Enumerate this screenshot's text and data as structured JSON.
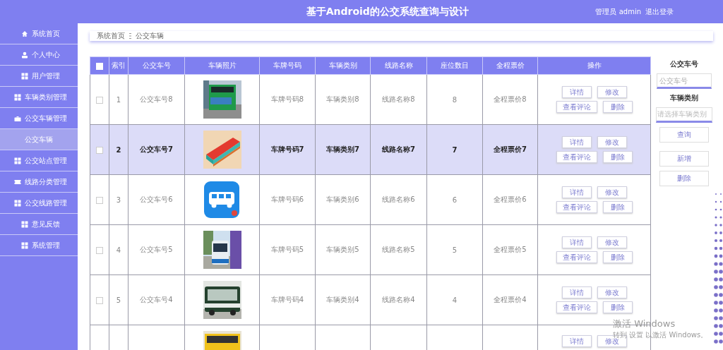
{
  "header": {
    "title": "基于Android的公交系统查询与设计",
    "user": "管理员 admin",
    "logout": "退出登录"
  },
  "sidebar": {
    "items": [
      {
        "label": "系统首页",
        "kind": "item",
        "selected": false
      },
      {
        "label": "个人中心",
        "kind": "item",
        "selected": false
      },
      {
        "label": "用户管理",
        "kind": "item",
        "selected": false
      },
      {
        "label": "车辆类别管理",
        "kind": "item",
        "selected": false
      },
      {
        "label": "公交车辆管理",
        "kind": "item",
        "selected": false
      },
      {
        "label": "公交车辆",
        "kind": "subitem",
        "selected": true
      },
      {
        "label": "公交站点管理",
        "kind": "item",
        "selected": false
      },
      {
        "label": "线路分类管理",
        "kind": "item",
        "selected": false
      },
      {
        "label": "公交线路管理",
        "kind": "item",
        "selected": false
      },
      {
        "label": "意见反馈",
        "kind": "item",
        "selected": false
      },
      {
        "label": "系统管理",
        "kind": "item",
        "selected": false
      }
    ]
  },
  "breadcrumb": [
    "系统首页",
    "公交车辆"
  ],
  "table": {
    "select_all": {
      "checked": false
    },
    "columns": [
      "索引",
      "公交车号",
      "车辆照片",
      "车牌号码",
      "车辆类别",
      "线路名称",
      "座位数目",
      "全程票价",
      "操作"
    ],
    "rows": [
      {
        "index": "1",
        "bus_no": "公交车号8",
        "photo": {
          "kind": "picture"
        },
        "plate": "车牌号码8",
        "category": "车辆类别8",
        "route": "线路名称8",
        "seats": "8",
        "fare": "全程票价8",
        "actions": [
          "详情",
          "修改",
          "查看评论",
          "删除"
        ],
        "selected": false,
        "checked": false
      },
      {
        "index": "2",
        "bus_no": "公交车号7",
        "photo": {
          "kind": "picture"
        },
        "plate": "车牌号码7",
        "category": "车辆类别7",
        "route": "线路名称7",
        "seats": "7",
        "fare": "全程票价7",
        "actions": [
          "详情",
          "修改",
          "查看评论",
          "删除"
        ],
        "selected": true,
        "checked": false
      },
      {
        "index": "3",
        "bus_no": "公交车号6",
        "photo": {
          "kind": "picture"
        },
        "plate": "车牌号码6",
        "category": "车辆类别6",
        "route": "线路名称6",
        "seats": "6",
        "fare": "全程票价6",
        "actions": [
          "详情",
          "修改",
          "查看评论",
          "删除"
        ],
        "selected": false,
        "checked": false
      },
      {
        "index": "4",
        "bus_no": "公交车号5",
        "photo": {
          "kind": "picture"
        },
        "plate": "车牌号码5",
        "category": "车辆类别5",
        "route": "线路名称5",
        "seats": "5",
        "fare": "全程票价5",
        "actions": [
          "详情",
          "修改",
          "查看评论",
          "删除"
        ],
        "selected": false,
        "checked": false
      },
      {
        "index": "5",
        "bus_no": "公交车号4",
        "photo": {
          "kind": "picture"
        },
        "plate": "车牌号码4",
        "category": "车辆类别4",
        "route": "线路名称4",
        "seats": "4",
        "fare": "全程票价4",
        "actions": [
          "详情",
          "修改",
          "查看评论",
          "删除"
        ],
        "selected": false,
        "checked": false
      },
      {
        "photo": {
          "kind": "picture"
        },
        "actions": [
          "详情",
          "修改"
        ],
        "selected": false
      }
    ]
  },
  "search": {
    "fields": [
      {
        "label": "公交车号",
        "placeholder": "公交车号",
        "kind": "input"
      },
      {
        "label": "车辆类别",
        "placeholder": "请选择车辆类别",
        "kind": "select"
      }
    ],
    "buttons": [
      "查询",
      "新增",
      "删除"
    ]
  },
  "os_notice": {
    "title": "激活 Windows",
    "text": "转到 设置 以激活 Windows。"
  }
}
